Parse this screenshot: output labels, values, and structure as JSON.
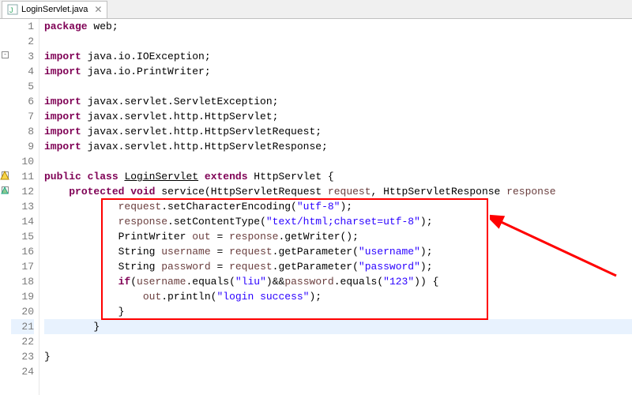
{
  "tab": {
    "title": "LoginServlet.java",
    "close_glyph": "✕"
  },
  "lines": {
    "l1": {
      "num": "1"
    },
    "l2": {
      "num": "2"
    },
    "l3": {
      "num": "3"
    },
    "l4": {
      "num": "4"
    },
    "l5": {
      "num": "5"
    },
    "l6": {
      "num": "6"
    },
    "l7": {
      "num": "7"
    },
    "l8": {
      "num": "8"
    },
    "l9": {
      "num": "9"
    },
    "l10": {
      "num": "10"
    },
    "l11": {
      "num": "11"
    },
    "l12": {
      "num": "12"
    },
    "l13": {
      "num": "13"
    },
    "l14": {
      "num": "14"
    },
    "l15": {
      "num": "15"
    },
    "l16": {
      "num": "16"
    },
    "l17": {
      "num": "17"
    },
    "l18": {
      "num": "18"
    },
    "l19": {
      "num": "19"
    },
    "l20": {
      "num": "20"
    },
    "l21": {
      "num": "21"
    },
    "l22": {
      "num": "22"
    },
    "l23": {
      "num": "23"
    },
    "l24": {
      "num": "24"
    }
  },
  "tok": {
    "package": "package",
    "import": "import",
    "public": "public",
    "class": "class",
    "extends": "extends",
    "protected": "protected",
    "void": "void",
    "if": "if",
    "web": " web;",
    "imp_ioexception": " java.io.IOException;",
    "imp_printwriter": " java.io.PrintWriter;",
    "imp_servletexception": " javax.servlet.ServletException;",
    "imp_httpservlet": " javax.servlet.http.HttpServlet;",
    "imp_httpservletrequest": " javax.servlet.http.HttpServletRequest;",
    "imp_httpservletresponse": " javax.servlet.http.HttpServletResponse;",
    "class_name": "LoginServlet",
    "httpservlet": " HttpServlet {",
    "service": "service",
    "sig_pre": "(HttpServletRequest ",
    "param_request": "request",
    "sig_mid": ", HttpServletResponse ",
    "param_response": "response",
    "indent8": "        ",
    "indent12": "            ",
    "request": "request",
    "response": "response",
    "setCharacterEncoding": ".setCharacterEncoding(",
    "setContentType": ".setContentType(",
    "str_utf8": "\"utf-8\"",
    "str_contenttype": "\"text/html;charset=utf-8\"",
    "close_paren_semi": ");",
    "pw_decl_pre": "PrintWriter ",
    "out": "out",
    "pw_decl_post": " = ",
    "getWriter": ".getWriter();",
    "string_decl": "String ",
    "username": "username",
    "password": "password",
    "eq_req": " = ",
    "getParameter": ".getParameter(",
    "str_username": "\"username\"",
    "str_password": "\"password\"",
    "if_open": "(",
    "equals": ".equals(",
    "str_liu": "\"liu\"",
    "and": ")&&",
    "str_123": "\"123\"",
    "if_close": ")) {",
    "println": ".println(",
    "str_login_success": "\"login success\"",
    "brace_close": "}",
    "indent4_close": "    }",
    "space": " ",
    "space4": "    "
  }
}
